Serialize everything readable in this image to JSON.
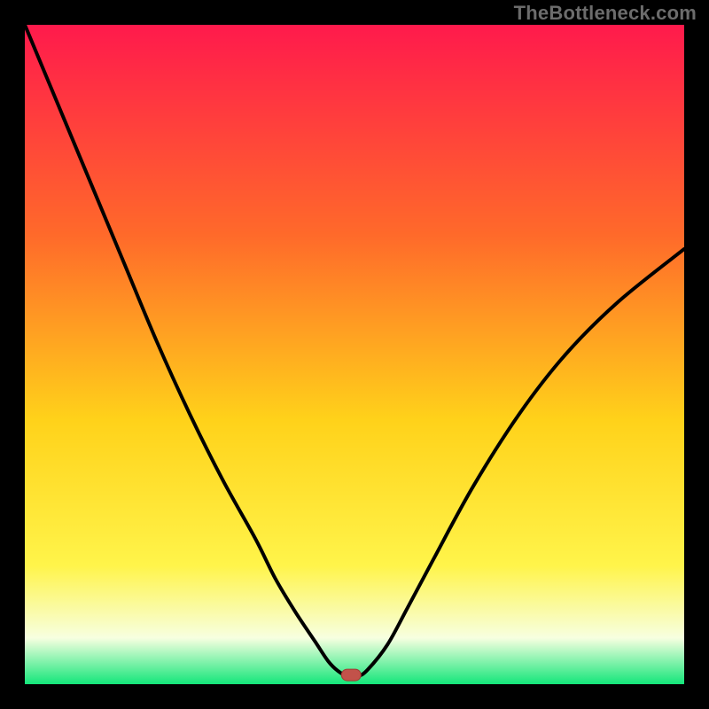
{
  "watermark": "TheBottleneck.com",
  "colors": {
    "background": "#000000",
    "grad_top": "#ff1a4c",
    "grad_mid1": "#ff6a2a",
    "grad_mid2": "#ffd21a",
    "grad_mid3": "#fff44a",
    "grad_mid4": "#f7ffe0",
    "grad_bottom": "#14e67a",
    "curve": "#000000",
    "marker_fill": "#c2524a",
    "marker_stroke": "#a13b34"
  },
  "chart_data": {
    "type": "line",
    "title": "",
    "xlabel": "",
    "ylabel": "",
    "xlim": [
      0,
      100
    ],
    "ylim": [
      0,
      100
    ],
    "series": [
      {
        "name": "bottleneck-curve",
        "x": [
          0,
          5,
          10,
          15,
          20,
          25,
          30,
          35,
          38,
          41,
          44,
          46,
          47.5,
          49,
          50.5,
          52,
          55,
          58,
          62,
          68,
          75,
          82,
          90,
          100
        ],
        "y": [
          100,
          88,
          76,
          64,
          52,
          41,
          31,
          22,
          16,
          11,
          6.5,
          3.5,
          2,
          1.2,
          1.2,
          2.2,
          6,
          11.5,
          19,
          30,
          41,
          50,
          58,
          66
        ]
      }
    ],
    "marker": {
      "x": 49.5,
      "y": 1.4,
      "label": ""
    },
    "flat_bottom": {
      "x0": 47.5,
      "x1": 51.5,
      "y": 1.2
    }
  }
}
